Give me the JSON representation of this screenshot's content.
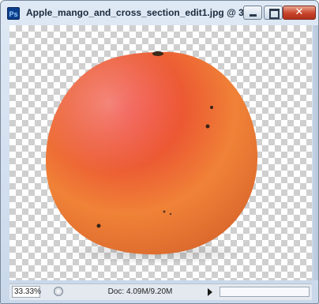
{
  "window": {
    "app_icon": "ps-app-icon",
    "app_icon_text": "Ps",
    "title": "Apple_mango_and_cross_section_edit1.jpg @ 33...",
    "controls": {
      "minimize": "minimize-icon",
      "maximize": "maximize-icon",
      "close": "close-icon",
      "close_glyph": "✕"
    }
  },
  "canvas": {
    "background": "transparency-checkerboard",
    "image": "mango"
  },
  "status": {
    "zoom": "33.33%",
    "doc": "Doc: 4.09M/9.20M",
    "menu_arrow": "triangle-right-icon"
  },
  "colors": {
    "mango_red": "#e8382c",
    "mango_orange": "#f07a35",
    "mango_yellow": "#f4a147"
  }
}
